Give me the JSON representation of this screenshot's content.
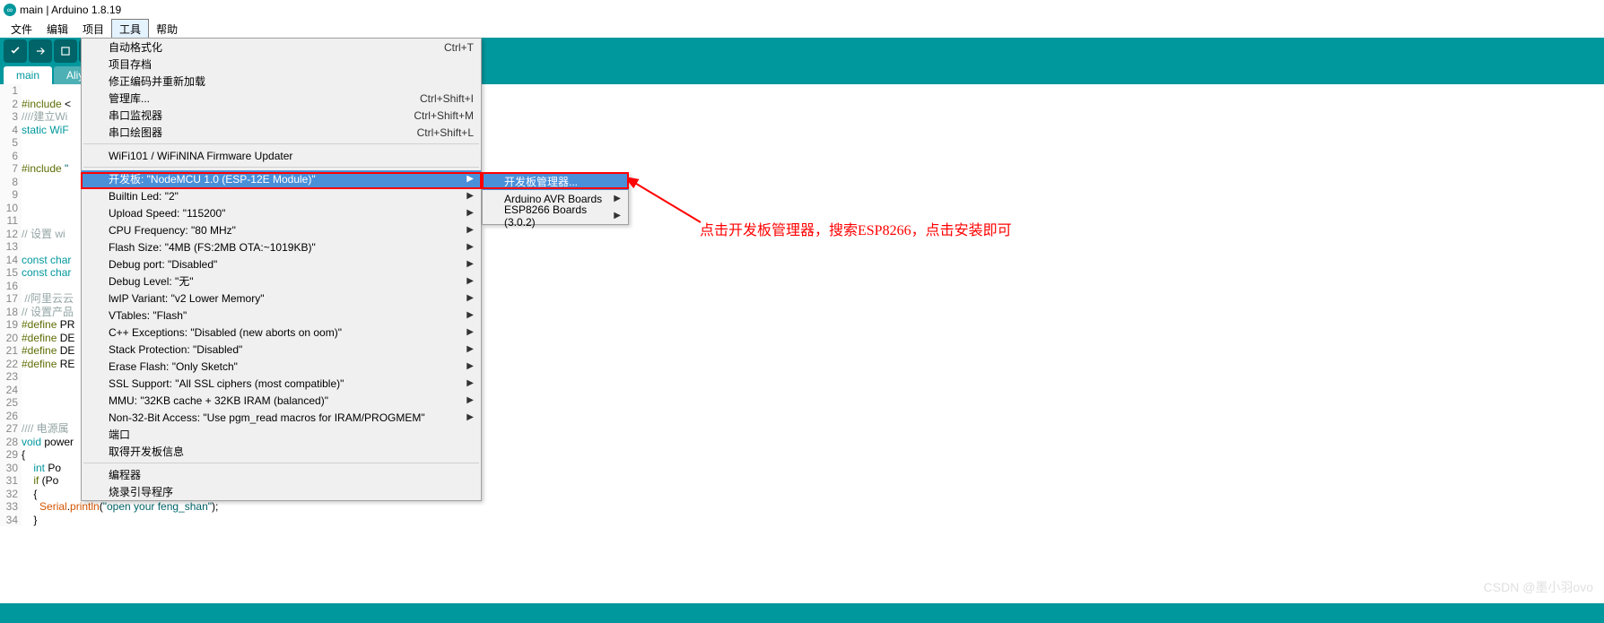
{
  "title": "main | Arduino 1.8.19",
  "menubar": [
    "文件",
    "编辑",
    "项目",
    "工具",
    "帮助"
  ],
  "active_menu": "工具",
  "tabs": [
    {
      "label": "main",
      "active": true
    },
    {
      "label": "Aliyu",
      "active": false
    }
  ],
  "code_lines": [
    {
      "n": 1,
      "html": ""
    },
    {
      "n": 2,
      "html": "<span class='kw-include'>#include</span> &lt;"
    },
    {
      "n": 3,
      "html": "<span class='comment'>////建立Wi</span>"
    },
    {
      "n": 4,
      "html": "<span class='kw-static'>static</span> <span class='kw-type'>WiF</span>"
    },
    {
      "n": 5,
      "html": ""
    },
    {
      "n": 6,
      "html": ""
    },
    {
      "n": 7,
      "html": "<span class='kw-include'>#include</span> <span class='str'>\"</span>"
    },
    {
      "n": 8,
      "html": ""
    },
    {
      "n": 9,
      "html": ""
    },
    {
      "n": 10,
      "html": ""
    },
    {
      "n": 11,
      "html": ""
    },
    {
      "n": 12,
      "html": "<span class='comment'>// 设置 wi</span>"
    },
    {
      "n": 13,
      "html": ""
    },
    {
      "n": 14,
      "html": "<span class='kw-const'>const</span> <span class='kw-type'>char</span>"
    },
    {
      "n": 15,
      "html": "<span class='kw-const'>const</span> <span class='kw-type'>char</span>"
    },
    {
      "n": 16,
      "html": ""
    },
    {
      "n": 17,
      "html": " <span class='comment'>//阿里云云</span>"
    },
    {
      "n": 18,
      "html": "<span class='comment'>// 设置产品</span>"
    },
    {
      "n": 19,
      "html": "<span class='kw-define'>#define</span> PR"
    },
    {
      "n": 20,
      "html": "<span class='kw-define'>#define</span> DE"
    },
    {
      "n": 21,
      "html": "<span class='kw-define'>#define</span> DE"
    },
    {
      "n": 22,
      "html": "<span class='kw-define'>#define</span> RE"
    },
    {
      "n": 23,
      "html": ""
    },
    {
      "n": 24,
      "html": ""
    },
    {
      "n": 25,
      "html": ""
    },
    {
      "n": 26,
      "html": ""
    },
    {
      "n": 27,
      "html": "<span class='comment'>//// 电源属</span>"
    },
    {
      "n": 28,
      "html": "<span class='kw-void'>void</span> power"
    },
    {
      "n": 29,
      "html": "{"
    },
    {
      "n": 30,
      "html": "    <span class='kw-type'>int</span> Po"
    },
    {
      "n": 31,
      "html": "    <span class='kw-if'>if</span> (Po"
    },
    {
      "n": 32,
      "html": "    {"
    },
    {
      "n": 33,
      "html": "      <span class='obj'>Serial</span>.<span class='obj'>println</span>(<span class='str'>\"open your feng_shan\"</span>);"
    },
    {
      "n": 34,
      "html": "    }"
    }
  ],
  "dropdown": {
    "groups": [
      [
        {
          "label": "自动格式化",
          "shortcut": "Ctrl+T"
        },
        {
          "label": "项目存档"
        },
        {
          "label": "修正编码并重新加载"
        },
        {
          "label": "管理库...",
          "shortcut": "Ctrl+Shift+I"
        },
        {
          "label": "串口监视器",
          "shortcut": "Ctrl+Shift+M"
        },
        {
          "label": "串口绘图器",
          "shortcut": "Ctrl+Shift+L"
        }
      ],
      [
        {
          "label": "WiFi101 / WiFiNINA Firmware Updater"
        }
      ],
      [
        {
          "label": "开发板: \"NodeMCU 1.0 (ESP-12E Module)\"",
          "arrow": true,
          "highlighted": true
        },
        {
          "label": "Builtin Led: \"2\"",
          "arrow": true
        },
        {
          "label": "Upload Speed: \"115200\"",
          "arrow": true
        },
        {
          "label": "CPU Frequency: \"80 MHz\"",
          "arrow": true
        },
        {
          "label": "Flash Size: \"4MB (FS:2MB OTA:~1019KB)\"",
          "arrow": true
        },
        {
          "label": "Debug port: \"Disabled\"",
          "arrow": true
        },
        {
          "label": "Debug Level: \"无\"",
          "arrow": true
        },
        {
          "label": "lwIP Variant: \"v2 Lower Memory\"",
          "arrow": true
        },
        {
          "label": "VTables: \"Flash\"",
          "arrow": true
        },
        {
          "label": "C++ Exceptions: \"Disabled (new aborts on oom)\"",
          "arrow": true
        },
        {
          "label": "Stack Protection: \"Disabled\"",
          "arrow": true
        },
        {
          "label": "Erase Flash: \"Only Sketch\"",
          "arrow": true
        },
        {
          "label": "SSL Support: \"All SSL ciphers (most compatible)\"",
          "arrow": true
        },
        {
          "label": "MMU: \"32KB cache + 32KB IRAM (balanced)\"",
          "arrow": true
        },
        {
          "label": "Non-32-Bit Access: \"Use pgm_read macros for IRAM/PROGMEM\"",
          "arrow": true
        },
        {
          "label": "端口"
        },
        {
          "label": "取得开发板信息"
        }
      ],
      [
        {
          "label": "编程器"
        },
        {
          "label": "烧录引导程序"
        }
      ]
    ]
  },
  "submenu": [
    {
      "label": "开发板管理器...",
      "highlighted": true
    },
    {
      "label": "Arduino AVR Boards",
      "arrow": true
    },
    {
      "label": "ESP8266 Boards (3.0.2)",
      "arrow": true
    }
  ],
  "annotation": "点击开发板管理器，搜索ESP8266，点击安装即可",
  "watermark": "CSDN @墨小羽ovo"
}
